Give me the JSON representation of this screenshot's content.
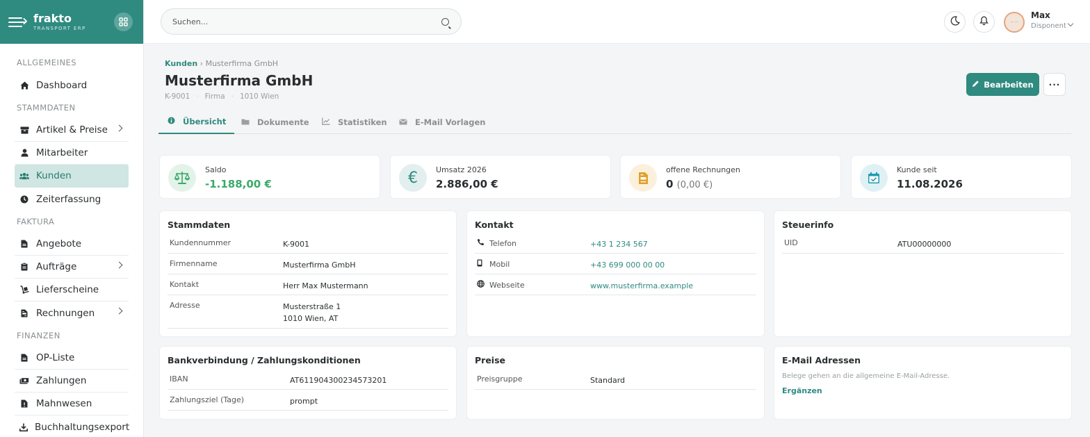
{
  "app": {
    "name": "frakto",
    "sub": "TRANSPORT ERP"
  },
  "search": {
    "placeholder": "Suchen..."
  },
  "user": {
    "name": "Max",
    "role": "Disponent",
    "avatar_text": "— —"
  },
  "sidebar": {
    "sections": [
      "ALLGEMEINES",
      "STAMMDATEN",
      "FAKTURA",
      "FINANZEN"
    ],
    "items": [
      {
        "label": "Dashboard",
        "icon": "home-icon"
      },
      {
        "label": "Artikel & Preise",
        "icon": "box-icon"
      },
      {
        "label": "Mitarbeiter",
        "icon": "user-icon"
      },
      {
        "label": "Kunden",
        "icon": "users-icon"
      },
      {
        "label": "Zeiterfassung",
        "icon": "clock-icon"
      },
      {
        "label": "Angebote",
        "icon": "file-icon"
      },
      {
        "label": "Aufträge",
        "icon": "clipboard-icon"
      },
      {
        "label": "Lieferscheine",
        "icon": "dolly-icon"
      },
      {
        "label": "Rechnungen",
        "icon": "invoice-icon"
      },
      {
        "label": "OP-Liste",
        "icon": "file-icon"
      },
      {
        "label": "Zahlungen",
        "icon": "money-icon"
      },
      {
        "label": "Mahnwesen",
        "icon": "file-warning-icon"
      },
      {
        "label": "Buchhaltungsexport",
        "icon": "download-icon"
      }
    ]
  },
  "breadcrumb": {
    "root": "Kunden",
    "current": "Musterfirma GmbH"
  },
  "customer": {
    "title": "Musterfirma GmbH",
    "number": "K-9001",
    "type": "Firma",
    "location": "1010 Wien"
  },
  "actions": {
    "edit": "Bearbeiten",
    "more": "···"
  },
  "tabs": [
    "Übersicht",
    "Dokumente",
    "Statistiken",
    "E-Mail Vorlagen"
  ],
  "stats": {
    "saldo": {
      "label": "Saldo",
      "value": "-1.188,00 €"
    },
    "umsatz": {
      "label": "Umsatz 2026",
      "value": "2.886,00 €"
    },
    "offen": {
      "label": "offene Rechnungen",
      "value": "0",
      "sub": "(0,00 €)"
    },
    "seit": {
      "label": "Kunde seit",
      "value": "11.08.2026"
    }
  },
  "stammdaten": {
    "title": "Stammdaten",
    "rows": [
      {
        "k": "Kundennummer",
        "v": "K-9001"
      },
      {
        "k": "Firmenname",
        "v": "Musterfirma GmbH"
      },
      {
        "k": "Kontakt",
        "v": "Herr Max Mustermann"
      },
      {
        "k": "Adresse",
        "v": "Musterstraße 1",
        "v2": "1010 Wien, AT"
      }
    ]
  },
  "kontakt": {
    "title": "Kontakt",
    "rows": [
      {
        "k": "Telefon",
        "v": "+43 1 234 567",
        "icon": "phone-icon"
      },
      {
        "k": "Mobil",
        "v": "+43 699 000 00 00",
        "icon": "mobile-icon"
      },
      {
        "k": "Webseite",
        "v": "www.musterfirma.example",
        "icon": "globe-icon"
      }
    ]
  },
  "steuer": {
    "title": "Steuerinfo",
    "rows": [
      {
        "k": "UID",
        "v": "ATU00000000"
      }
    ]
  },
  "bank": {
    "title": "Bankverbindung / Zahlungskonditionen",
    "rows": [
      {
        "k": "IBAN",
        "v": "AT611904300234573201"
      },
      {
        "k": "Zahlungsziel (Tage)",
        "v": "prompt"
      }
    ]
  },
  "preise": {
    "title": "Preise",
    "rows": [
      {
        "k": "Preisgruppe",
        "v": "Standard"
      }
    ]
  },
  "email": {
    "title": "E-Mail Adressen",
    "note": "Belege gehen an die allgemeine E-Mail-Adresse.",
    "add": "Ergänzen"
  },
  "colors": {
    "accent": "#2f8a80",
    "active_bg": "#cfe6e3",
    "saldo": "#3aaa6a",
    "warning": "#e2a028"
  }
}
